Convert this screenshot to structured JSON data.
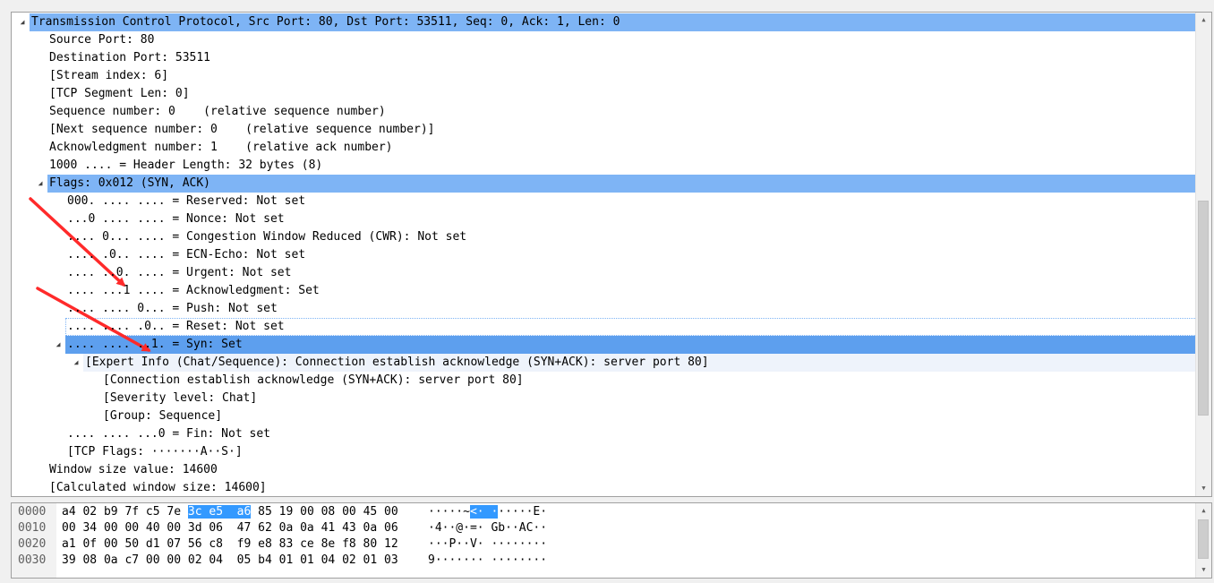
{
  "detail_tree": {
    "rows": [
      {
        "text": "Transmission Control Protocol, Src Port: 80, Dst Port: 53511, Seq: 0, Ack: 1, Len: 0",
        "toggle": "expanded",
        "depth": 0,
        "state": "sel"
      },
      {
        "text": "Source Port: 80",
        "toggle": "none",
        "depth": 1,
        "state": ""
      },
      {
        "text": "Destination Port: 53511",
        "toggle": "none",
        "depth": 1,
        "state": ""
      },
      {
        "text": "[Stream index: 6]",
        "toggle": "none",
        "depth": 1,
        "state": ""
      },
      {
        "text": "[TCP Segment Len: 0]",
        "toggle": "none",
        "depth": 1,
        "state": ""
      },
      {
        "text": "Sequence number: 0    (relative sequence number)",
        "toggle": "none",
        "depth": 1,
        "state": ""
      },
      {
        "text": "[Next sequence number: 0    (relative sequence number)]",
        "toggle": "none",
        "depth": 1,
        "state": ""
      },
      {
        "text": "Acknowledgment number: 1    (relative ack number)",
        "toggle": "none",
        "depth": 1,
        "state": ""
      },
      {
        "text": "1000 .... = Header Length: 32 bytes (8)",
        "toggle": "none",
        "depth": 1,
        "state": ""
      },
      {
        "text": "Flags: 0x012 (SYN, ACK)",
        "toggle": "expanded",
        "depth": 1,
        "state": "sel"
      },
      {
        "text": "000. .... .... = Reserved: Not set",
        "toggle": "none",
        "depth": 2,
        "state": ""
      },
      {
        "text": "...0 .... .... = Nonce: Not set",
        "toggle": "none",
        "depth": 2,
        "state": ""
      },
      {
        "text": ".... 0... .... = Congestion Window Reduced (CWR): Not set",
        "toggle": "none",
        "depth": 2,
        "state": ""
      },
      {
        "text": ".... .0.. .... = ECN-Echo: Not set",
        "toggle": "none",
        "depth": 2,
        "state": ""
      },
      {
        "text": ".... ..0. .... = Urgent: Not set",
        "toggle": "none",
        "depth": 2,
        "state": ""
      },
      {
        "text": ".... ...1 .... = Acknowledgment: Set",
        "toggle": "none",
        "depth": 2,
        "state": ""
      },
      {
        "text": ".... .... 0... = Push: Not set",
        "toggle": "none",
        "depth": 2,
        "state": ""
      },
      {
        "text": ".... .... .0.. = Reset: Not set",
        "toggle": "none",
        "depth": 2,
        "state": "focus"
      },
      {
        "text": ".... .... ..1. = Syn: Set",
        "toggle": "expanded",
        "depth": 2,
        "state": "sel-strong"
      },
      {
        "text": "[Expert Info (Chat/Sequence): Connection establish acknowledge (SYN+ACK): server port 80]",
        "toggle": "expanded",
        "depth": 3,
        "state": "hover"
      },
      {
        "text": "[Connection establish acknowledge (SYN+ACK): server port 80]",
        "toggle": "none",
        "depth": 4,
        "state": ""
      },
      {
        "text": "[Severity level: Chat]",
        "toggle": "none",
        "depth": 4,
        "state": ""
      },
      {
        "text": "[Group: Sequence]",
        "toggle": "none",
        "depth": 4,
        "state": ""
      },
      {
        "text": ".... .... ...0 = Fin: Not set",
        "toggle": "none",
        "depth": 2,
        "state": ""
      },
      {
        "text": "[TCP Flags: ·······A··S·]",
        "toggle": "none",
        "depth": 2,
        "state": ""
      },
      {
        "text": "Window size value: 14600",
        "toggle": "none",
        "depth": 1,
        "state": ""
      },
      {
        "text": "[Calculated window size: 14600]",
        "toggle": "none",
        "depth": 1,
        "state": ""
      }
    ]
  },
  "bytes_pane": {
    "rows": [
      {
        "offset": "0000",
        "hex_pre": "a4 02 b9 7f c5 7e ",
        "hex_sel": "3c e5  a6",
        "hex_post": " 85 19 00 08 00 45 00",
        "ascii_pre": "·····~",
        "ascii_sel": "<· ·",
        "ascii_post": "·····E·"
      },
      {
        "offset": "0010",
        "hex_pre": "00 34 00 00 40 00 3d 06  47 62 0a 0a 41 43 0a 06",
        "hex_sel": "",
        "hex_post": "",
        "ascii_pre": "·4··@·=· Gb··AC··",
        "ascii_sel": "",
        "ascii_post": ""
      },
      {
        "offset": "0020",
        "hex_pre": "a1 0f 00 50 d1 07 56 c8  f9 e8 83 ce 8e f8 80 12",
        "hex_sel": "",
        "hex_post": "",
        "ascii_pre": "···P··V· ········",
        "ascii_sel": "",
        "ascii_post": ""
      },
      {
        "offset": "0030",
        "hex_pre": "39 08 0a c7 00 00 02 04  05 b4 01 01 04 02 01 03",
        "hex_sel": "",
        "hex_post": "",
        "ascii_pre": "9······· ········",
        "ascii_sel": "",
        "ascii_post": ""
      }
    ]
  },
  "icons": {
    "expanded_toggle": "triangle-down-icon",
    "scroll_up": "arrow-up-icon",
    "scroll_down": "arrow-down-icon"
  },
  "colors": {
    "selection": "#7eb4f5",
    "selection_strong": "#5d9fee",
    "hex_selection": "#3399ff",
    "annotation_arrow": "#ff2a2a"
  }
}
